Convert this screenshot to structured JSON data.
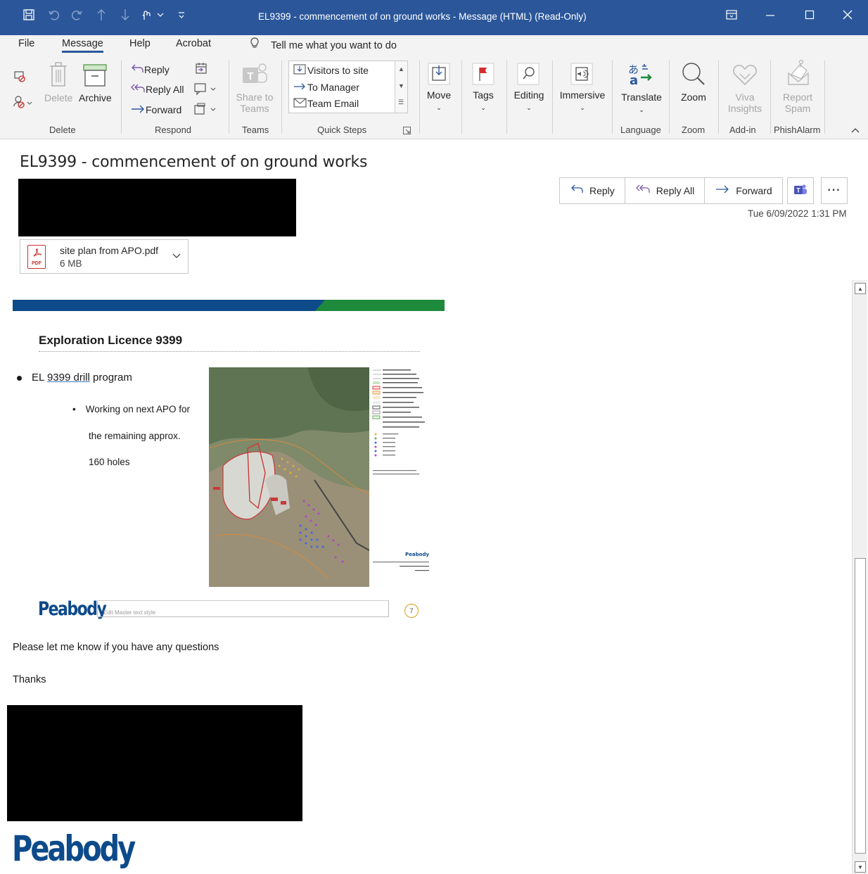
{
  "window": {
    "title": "EL9399 - commencement of on ground works  -  Message (HTML) (Read-Only)",
    "quick_access": [
      "save-icon",
      "undo-icon",
      "redo-icon",
      "up-icon",
      "down-icon",
      "touch-mode-icon",
      "customize-icon"
    ],
    "controls": [
      "ribbon-display-icon",
      "minimize-icon",
      "maximize-icon",
      "close-icon"
    ]
  },
  "menu": {
    "tabs": [
      "File",
      "Message",
      "Help",
      "Acrobat"
    ],
    "active": "Message",
    "tell_me": "Tell me what you want to do"
  },
  "ribbon": {
    "delete_group": {
      "label": "Delete",
      "delete": "Delete",
      "archive": "Archive"
    },
    "respond_group": {
      "label": "Respond",
      "reply": "Reply",
      "reply_all": "Reply All",
      "forward": "Forward"
    },
    "teams_group": {
      "label": "Teams",
      "share_line1": "Share to",
      "share_line2": "Teams"
    },
    "quick_steps": {
      "label": "Quick Steps",
      "items": [
        "Visitors to site",
        "To Manager",
        "Team Email"
      ]
    },
    "move": "Move",
    "tags": "Tags",
    "editing": "Editing",
    "immersive": "Immersive",
    "language_group": {
      "label": "Language",
      "translate": "Translate"
    },
    "zoom_group": {
      "label": "Zoom",
      "zoom": "Zoom"
    },
    "addin_group": {
      "label": "Add-in",
      "viva_line1": "Viva",
      "viva_line2": "Insights"
    },
    "phish_group": {
      "label": "PhishAlarm",
      "report_line1": "Report",
      "report_line2": "Spam"
    }
  },
  "message": {
    "subject": "EL9399 - commencement of on ground works",
    "actions": {
      "reply": "Reply",
      "reply_all": "Reply All",
      "forward": "Forward"
    },
    "datetime": "Tue 6/09/2022 1:31 PM",
    "attachment": {
      "name": "site plan from APO.pdf",
      "size": "6 MB",
      "type_badge": "PDF"
    },
    "slide": {
      "title": "Exploration Licence 9399",
      "bullet_pre": "EL ",
      "bullet_ul": "9399 drill",
      "bullet_post": " program",
      "sub_lines": [
        "Working on next APO for",
        "the remaining approx.",
        "160 holes"
      ],
      "footer_logo": "Peabody",
      "master_text": "Edit Master text style",
      "page_number": "7"
    },
    "body_lines": [
      "Please let me know if you have any questions",
      "Thanks"
    ],
    "signature_logo": "Peabody"
  },
  "colors": {
    "titlebar": "#2b579a",
    "ribbon_bg": "#f3f3f3",
    "band_blue": "#0d4a8a",
    "band_green": "#1e8a3c",
    "accent": "#2b579a"
  }
}
